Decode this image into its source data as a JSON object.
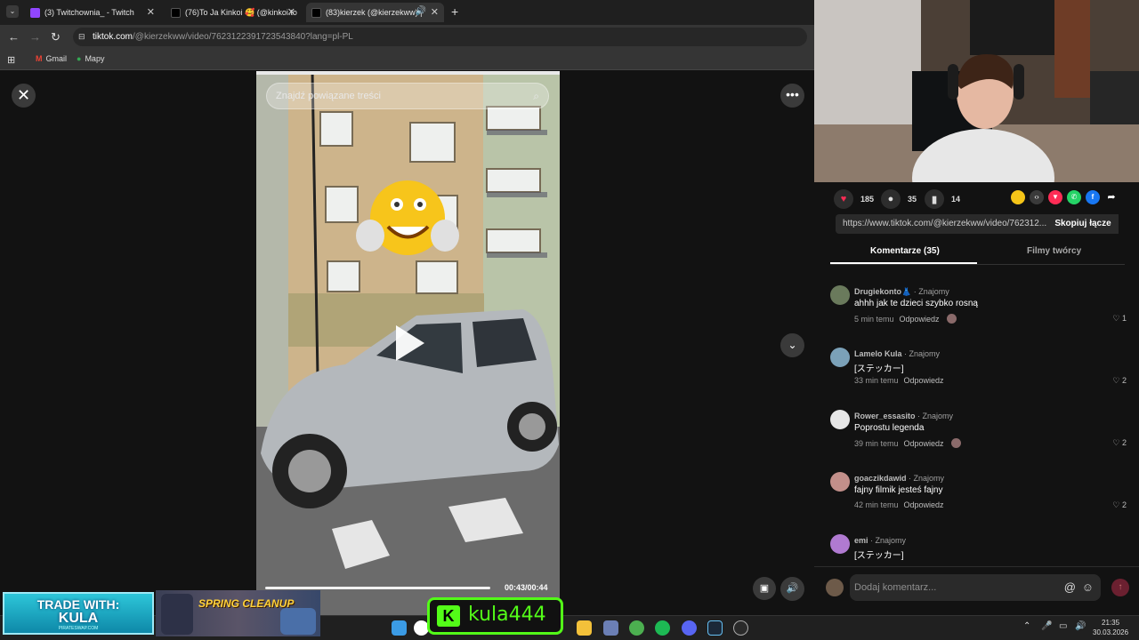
{
  "browser": {
    "tabs": [
      {
        "title": "(3) Twitchownia_ - Twitch",
        "active": false
      },
      {
        "title": "(76)To Ja Kinkoi 🥰 (@kinkoi.to",
        "active": false
      },
      {
        "title": "(83)kierzek (@kierzekww) |",
        "active": true
      }
    ],
    "new_tab": "+",
    "url_domain": "tiktok.com",
    "url_path": "/@kierzekww/video/7623122391723543840?lang=pl-PL",
    "bookmarks": [
      {
        "label": "Gmail"
      },
      {
        "label": "Mapy"
      }
    ]
  },
  "video": {
    "search_placeholder": "Znajdź powiązane treści",
    "time": "00:43/00:44",
    "progress_fraction": 0.977
  },
  "stats": {
    "likes": "185",
    "comments": "35",
    "saves": "14"
  },
  "share_link": {
    "url": "https://www.tiktok.com/@kierzekww/video/762312...",
    "copy_label": "Skopiuj łącze"
  },
  "panel_tabs": {
    "comments": "Komentarze (35)",
    "creator": "Filmy twórcy"
  },
  "comments": [
    {
      "user": "Drugiekonto👗",
      "tag": " · Znajomy",
      "text": "ahhh jak te dzieci szybko rosną",
      "time": "5 min temu",
      "reply": "Odpowiedz",
      "likes": "1"
    },
    {
      "user": "Lamelo Kula",
      "tag": " · Znajomy",
      "text": "[ステッカー]",
      "time": "33 min temu",
      "reply": "Odpowiedz",
      "likes": "2"
    },
    {
      "user": "Rower_essasito",
      "tag": " · Znajomy",
      "text": "Poprostu legenda",
      "time": "39 min temu",
      "reply": "Odpowiedz",
      "likes": "2"
    },
    {
      "user": "goaczikdawid",
      "tag": " · Znajomy",
      "text": "fajny filmik jesteś fajny",
      "time": "42 min temu",
      "reply": "Odpowiedz",
      "likes": "2"
    },
    {
      "user": "emi",
      "tag": " · Znajomy",
      "text": "[ステッカー]",
      "time": "",
      "reply": "",
      "likes": ""
    }
  ],
  "compose": {
    "placeholder": "Dodaj komentarz..."
  },
  "overlays": {
    "trade_title": "TRADE WITH:",
    "trade_name": "KULA",
    "trade_site": "PIRATESWAP.COM",
    "spring": "SPRING CLEANUP",
    "kick_name": "kula444"
  },
  "taskbar": {
    "time": "21:35",
    "date": "30.03.2026"
  },
  "colors": {
    "kick_green": "#53fc18",
    "tiktok_red": "#fe2c55"
  }
}
